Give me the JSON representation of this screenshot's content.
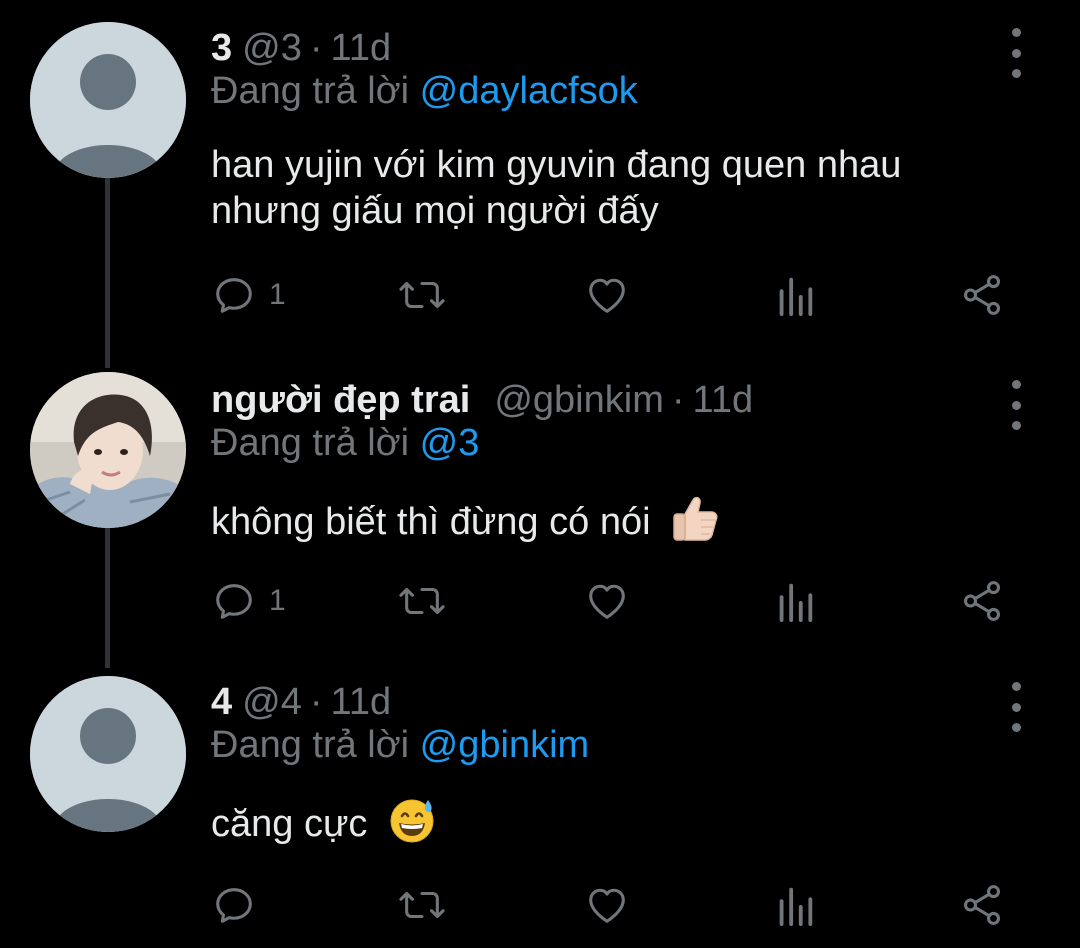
{
  "tweets": [
    {
      "name": "3",
      "handle": "@3",
      "dot": "·",
      "time": "11d",
      "replying_prefix": "Đang trả lời ",
      "replying_to": "@daylacfsok",
      "text": "han yujin với kim gyuvin đang quen nhau nhưng giấu mọi người đấy",
      "emoji": "",
      "reply_count": "1",
      "avatar": "default-avatar"
    },
    {
      "name": "người đẹp trai",
      "handle": "@gbinkim",
      "dot": "·",
      "time": "11d",
      "replying_prefix": "Đang trả lời ",
      "replying_to": "@3",
      "text": "không biết thì đừng có nói",
      "emoji": "thumbs-up-light-skin",
      "reply_count": "1",
      "avatar": "photo-avatar"
    },
    {
      "name": "4",
      "handle": "@4",
      "dot": "·",
      "time": "11d",
      "replying_prefix": "Đang trả lời ",
      "replying_to": "@gbinkim",
      "text": "căng cực",
      "emoji": "grinning-sweat",
      "reply_count": "",
      "avatar": "default-avatar"
    }
  ],
  "colors": {
    "background": "#000000",
    "text": "#e7e9ea",
    "secondary": "#71767b",
    "mention": "#1d9bf0",
    "thread_line": "#2f3336",
    "avatar_bg": "#ccd6dd",
    "avatar_fg": "#66757f"
  }
}
